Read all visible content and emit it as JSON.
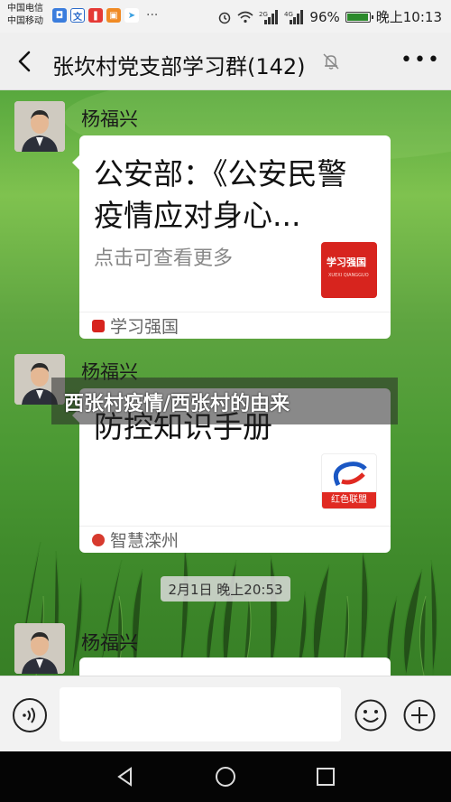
{
  "status_bar": {
    "carrier_1": "中国电信",
    "carrier_2": "中国移动",
    "battery": "96%",
    "battery_level": 0.96,
    "time": "晚上10:13",
    "net_1": "2G",
    "net_2": "4G"
  },
  "header": {
    "title": "张坎村党支部学习群(142)"
  },
  "messages": [
    {
      "sender": "杨福兴",
      "card_title": "公安部：《公安民警疫情应对身心...",
      "card_desc": "点击可查看更多",
      "source": "学习强国",
      "thumb_text": "学习强国",
      "thumb_sub": "XUEXI QIANGGUO"
    },
    {
      "sender": "杨福兴",
      "card_title": "防控知识手册",
      "source": "智慧滦州",
      "thumb_text": "红色联盟"
    },
    {
      "sender": "杨福兴"
    }
  ],
  "timestamp": "2月1日 晚上20:53",
  "overlay": {
    "text": "西张村疫情/西张村的由来"
  },
  "colors": {
    "xuexi_red": "#d7241e",
    "header_bg": "#efefef",
    "nav_bg": "#050505"
  }
}
